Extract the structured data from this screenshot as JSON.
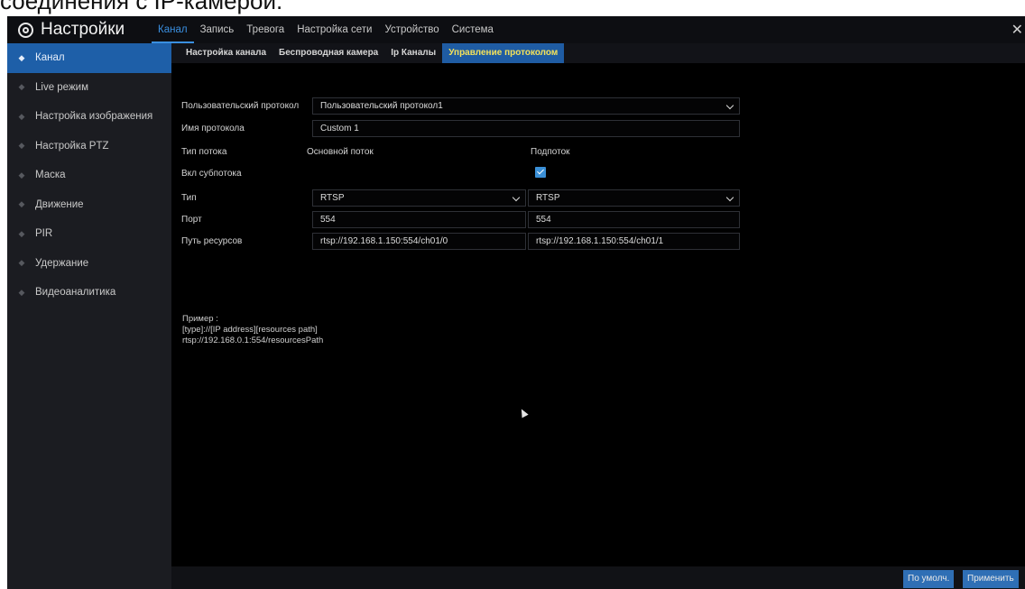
{
  "caption": "соединения с IP-камерой.",
  "app": {
    "title": "Настройки",
    "close_symbol": "✕"
  },
  "top_nav": [
    {
      "label": "Канал",
      "active": true
    },
    {
      "label": "Запись"
    },
    {
      "label": "Тревога"
    },
    {
      "label": "Настройка сети"
    },
    {
      "label": "Устройство"
    },
    {
      "label": "Система"
    }
  ],
  "sidebar": [
    {
      "label": "Канал",
      "active": true
    },
    {
      "label": "Live режим"
    },
    {
      "label": "Настройка изображения"
    },
    {
      "label": "Настройка PTZ"
    },
    {
      "label": "Маска"
    },
    {
      "label": "Движение"
    },
    {
      "label": "PIR"
    },
    {
      "label": "Удержание"
    },
    {
      "label": "Видеоаналитика"
    }
  ],
  "sub_tabs": [
    {
      "label": "Настройка канала"
    },
    {
      "label": "Беспроводная камера"
    },
    {
      "label": "Ip Каналы"
    },
    {
      "label": "Управление протоколом",
      "active": true
    }
  ],
  "form": {
    "custom_protocol_label": "Пользовательский протокол",
    "custom_protocol_value": "Пользовательский протокол1",
    "protocol_name_label": "Имя протокола",
    "protocol_name_value": "Custom 1",
    "stream_type_label": "Тип потока",
    "main_stream_header": "Основной поток",
    "sub_stream_header": "Подпоток",
    "enable_substream_label": "Вкл субпотока",
    "substream_enabled": true,
    "type_label": "Тип",
    "main_type_value": "RTSP",
    "sub_type_value": "RTSP",
    "port_label": "Порт",
    "main_port_value": "554",
    "sub_port_value": "554",
    "resource_path_label": "Путь ресурсов",
    "main_path_value": "rtsp://192.168.1.150:554/ch01/0",
    "sub_path_value": "rtsp://192.168.1.150:554/ch01/1"
  },
  "example": {
    "title": "Пример :",
    "line1": "[type]://[IP address][resources path]",
    "line2": "rtsp://192.168.0.1:554/resourcesPath"
  },
  "buttons": {
    "default": "По умолч.",
    "apply": "Применить"
  },
  "colors": {
    "accent": "#1e5fa8",
    "active_tab_text": "#f4e25a",
    "link_active": "#3a8fe0"
  }
}
